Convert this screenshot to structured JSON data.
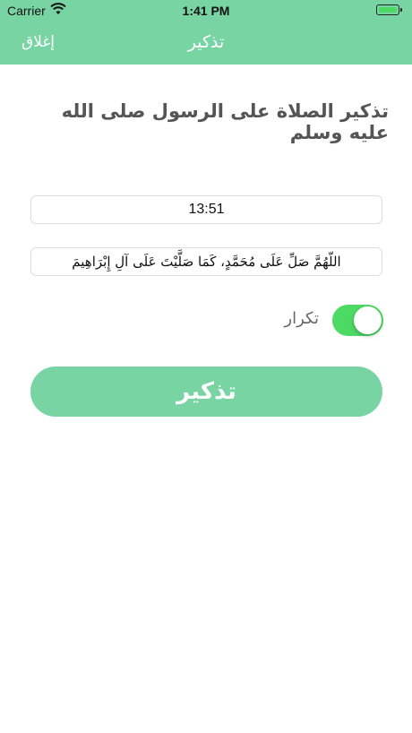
{
  "status_bar": {
    "carrier": "Carrier",
    "time": "1:41 PM",
    "battery_level": 1.0
  },
  "nav": {
    "title": "تذكير",
    "close_label": "إغلاق"
  },
  "main": {
    "heading": "تذكير الصلاة على الرسول صلى الله عليه وسلم",
    "time_value": "13:51",
    "message_value": "اللّهُمَّ صَلِّ عَلَى مُحَمَّدٍ، كَمَا صَلَّيْتَ عَلَى آلِ إِبْرَاهِيمَ",
    "repeat_label": "تكرار",
    "repeat_on": true,
    "submit_label": "تذكير"
  },
  "colors": {
    "accent": "#79d4a4",
    "toggle_on": "#4cd964"
  }
}
